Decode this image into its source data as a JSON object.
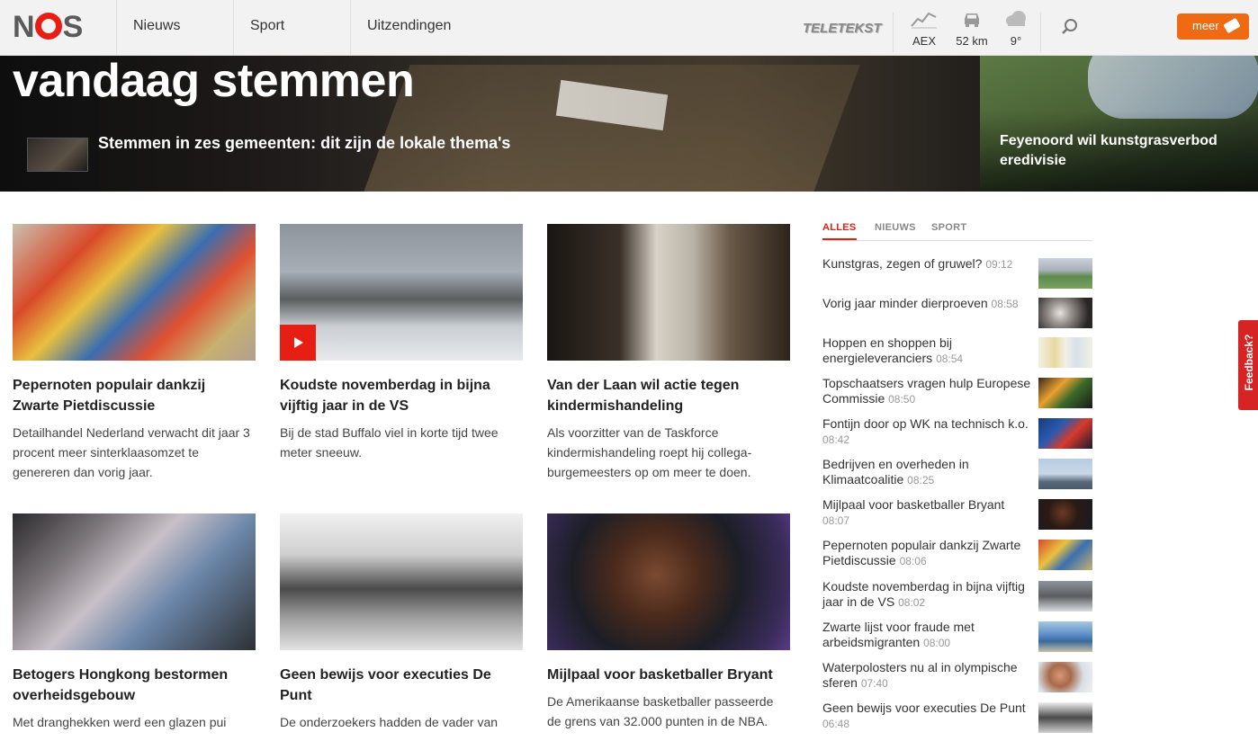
{
  "header": {
    "logo": "NOS",
    "nav": [
      "Nieuws",
      "Sport",
      "Uitzendingen"
    ],
    "teletekst": "TELETEKST",
    "widgets": [
      {
        "label": "AEX",
        "icon": "chart-icon"
      },
      {
        "label": "52 km",
        "icon": "car-icon"
      },
      {
        "label": "9°",
        "icon": "cloud-icon"
      }
    ],
    "meer_label": "meer"
  },
  "hero": {
    "title": "vandaag stemmen",
    "subtitle": "Stemmen in zes gemeenten: dit zijn de lokale thema's",
    "side_title": "Feyenoord wil kunstgrasverbod eredivisie"
  },
  "articles": [
    {
      "title": "Pepernoten populair dankzij Zwarte Pietdiscussie",
      "desc": "Detailhandel Nederland verwacht dit jaar 3 procent meer sinterklaasomzet te genereren dan vorig jaar."
    },
    {
      "title": "Koudste novemberdag in bijna vijftig jaar in de VS",
      "desc": "Bij de stad Buffalo viel in korte tijd twee meter sneeuw."
    },
    {
      "title": "Van der Laan wil actie tegen kindermishandeling",
      "desc": "Als voorzitter van de Taskforce kindermishandeling roept hij collega-burgemeesters op om meer te doen."
    },
    {
      "title": "Betogers Hongkong bestormen overheidsgebouw",
      "desc": "Met dranghekken werd een glazen pui"
    },
    {
      "title": "Geen bewijs voor executies De Punt",
      "desc": "De onderzoekers hadden de vader van"
    },
    {
      "title": "Mijlpaal voor basketballer Bryant",
      "desc": "De Amerikaanse basketballer passeerde de grens van 32.000 punten in de NBA."
    }
  ],
  "sidebar": {
    "tabs": [
      "ALLES",
      "NIEUWS",
      "SPORT"
    ],
    "items": [
      {
        "text": "Kunstgras, zegen of gruwel?",
        "time": "09:12"
      },
      {
        "text": "Vorig jaar minder dierproeven",
        "time": "08:58"
      },
      {
        "text": "Hoppen en shoppen bij energieleveranciers",
        "time": "08:54"
      },
      {
        "text": "Topschaatsers vragen hulp Europese Commissie",
        "time": "08:50"
      },
      {
        "text": "Fontijn door op WK na technisch k.o.",
        "time": "08:42"
      },
      {
        "text": "Bedrijven en overheden in Klimaatcoalitie",
        "time": "08:25"
      },
      {
        "text": "Mijlpaal voor basketballer Bryant",
        "time": "08:07"
      },
      {
        "text": "Pepernoten populair dankzij Zwarte Pietdiscussie",
        "time": "08:06"
      },
      {
        "text": "Koudste novemberdag in bijna vijftig jaar in de VS",
        "time": "08:02"
      },
      {
        "text": "Zwarte lijst voor fraude met arbeidsmigranten",
        "time": "08:00"
      },
      {
        "text": "Waterpolosters nu al in olympische sferen",
        "time": "07:40"
      },
      {
        "text": "Geen bewijs voor executies De Punt",
        "time": "06:48"
      }
    ]
  },
  "feedback_label": "Feedback?",
  "colors": {
    "brand_red": "#e61e14",
    "accent_orange": "#f06a14"
  }
}
